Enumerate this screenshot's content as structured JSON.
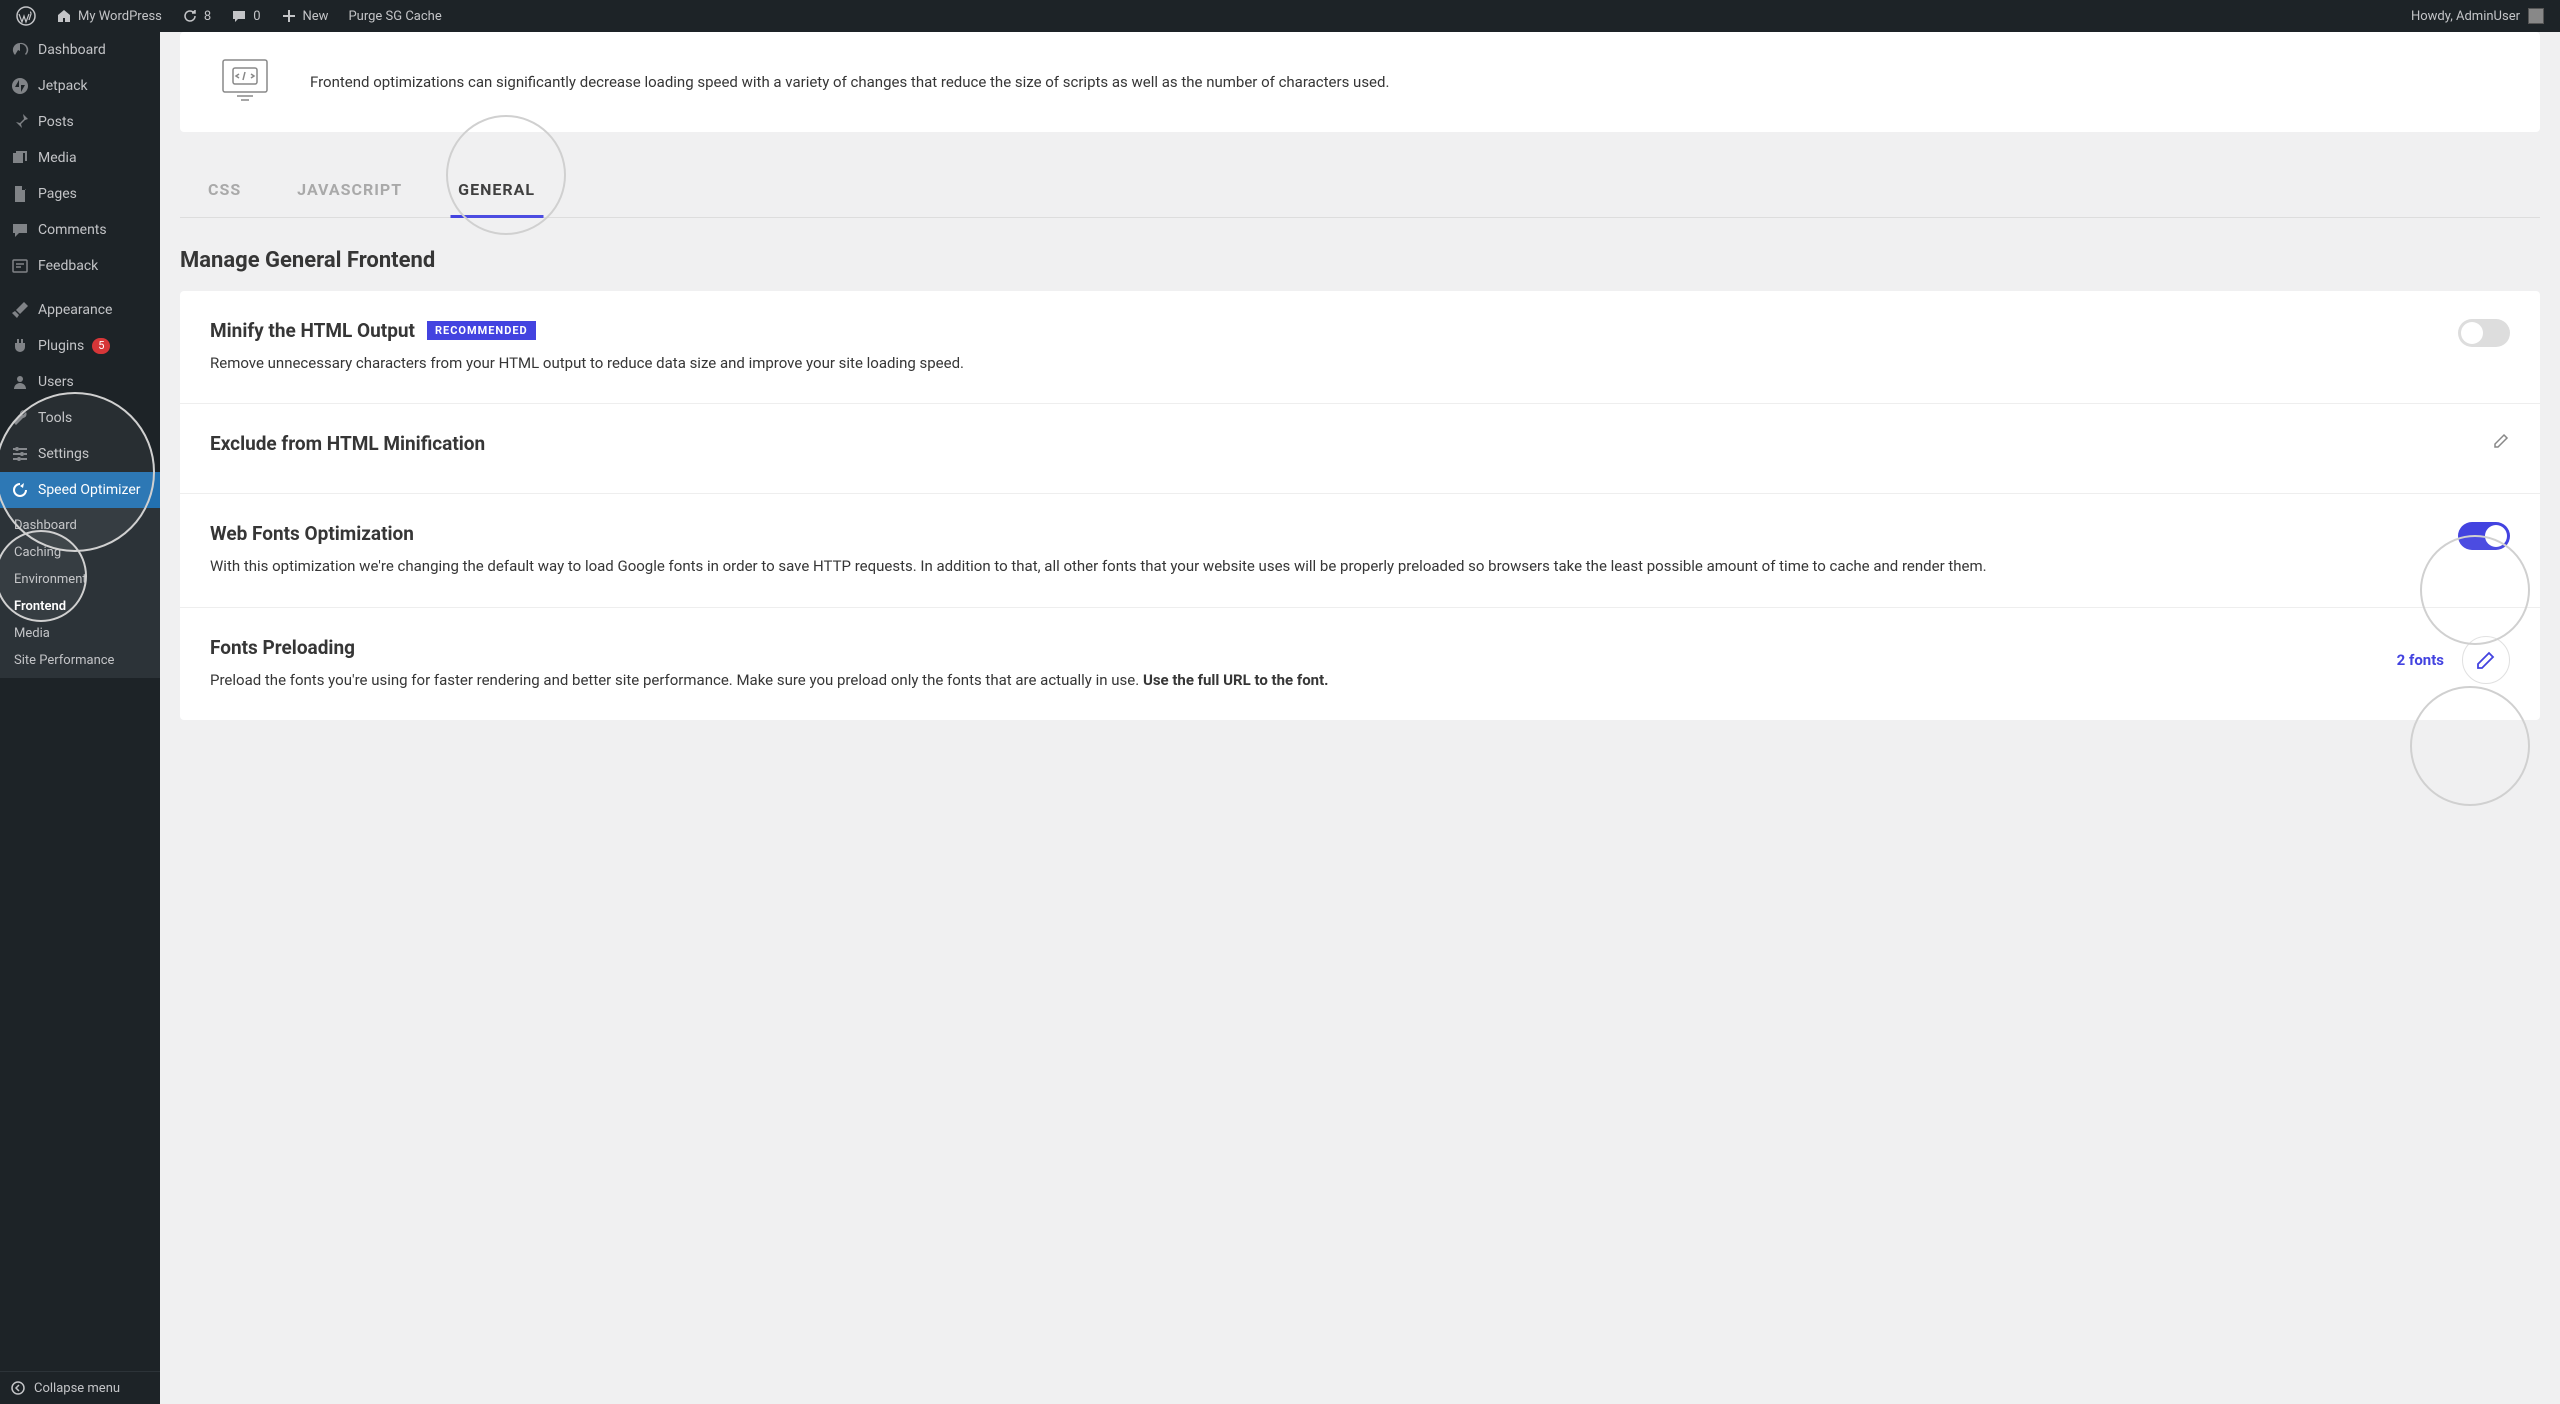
{
  "adminbar": {
    "site": "My WordPress",
    "updates": "8",
    "comments": "0",
    "new": "New",
    "purge": "Purge SG Cache",
    "howdy": "Howdy, AdminUser"
  },
  "sidebar": {
    "items": [
      {
        "label": "Dashboard"
      },
      {
        "label": "Jetpack"
      },
      {
        "label": "Posts"
      },
      {
        "label": "Media"
      },
      {
        "label": "Pages"
      },
      {
        "label": "Comments"
      },
      {
        "label": "Feedback"
      },
      {
        "label": "Appearance"
      },
      {
        "label": "Plugins",
        "badge": "5"
      },
      {
        "label": "Users"
      },
      {
        "label": "Tools"
      },
      {
        "label": "Settings"
      },
      {
        "label": "Speed Optimizer"
      }
    ],
    "submenu": [
      "Dashboard",
      "Caching",
      "Environment",
      "Frontend",
      "Media",
      "Site Performance"
    ],
    "collapse": "Collapse menu"
  },
  "intro": "Frontend optimizations can significantly decrease loading speed with a variety of changes that reduce the size of scripts as well as the number of characters used.",
  "tabs": [
    "CSS",
    "JAVASCRIPT",
    "GENERAL"
  ],
  "section_title": "Manage General Frontend",
  "settings": {
    "minify": {
      "title": "Minify the HTML Output",
      "badge": "RECOMMENDED",
      "desc": "Remove unnecessary characters from your HTML output to reduce data size and improve your site loading speed."
    },
    "exclude": {
      "title": "Exclude from HTML Minification"
    },
    "webfonts": {
      "title": "Web Fonts Optimization",
      "desc": "With this optimization we're changing the default way to load Google fonts in order to save HTTP requests. In addition to that, all other fonts that your website uses will be properly preloaded so browsers take the least possible amount of time to cache and render them."
    },
    "preload": {
      "title": "Fonts Preloading",
      "desc": "Preload the fonts you're using for faster rendering and better site performance. Make sure you preload only the fonts that are actually in use.",
      "desc_bold": "Use the full URL to the font.",
      "count": "2 fonts"
    }
  }
}
